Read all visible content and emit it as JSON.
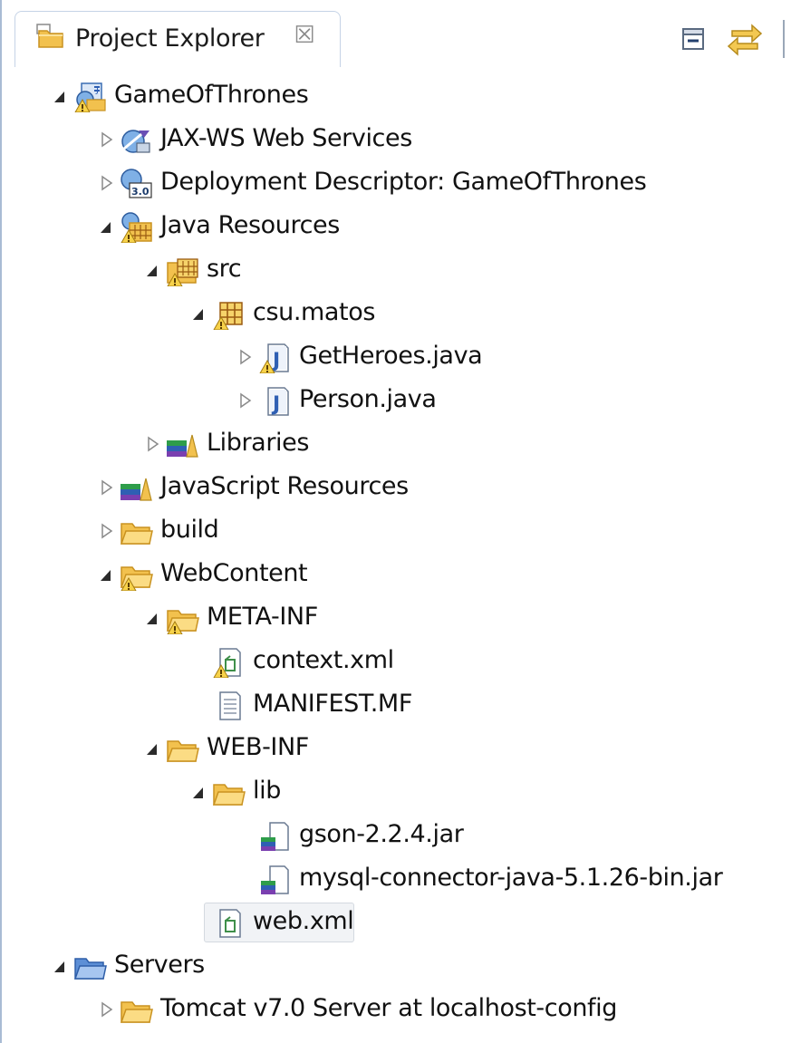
{
  "panel": {
    "title": "Project Explorer",
    "close_glyph": "☒",
    "toolbar": [
      {
        "name": "collapse-all-icon"
      },
      {
        "name": "link-with-editor-icon"
      }
    ]
  },
  "colors": {
    "folder": "#f2c14e",
    "folder_dark": "#c99220",
    "server_folder": "#5d8fd6",
    "java_blue": "#2f5fb3",
    "selection": "#f1f3f6"
  },
  "tree": [
    {
      "label": "GameOfThrones",
      "icon": "web-project-icon",
      "expand": "expanded",
      "level": 0,
      "warn": true
    },
    {
      "label": "JAX-WS Web Services",
      "icon": "webservices-icon",
      "expand": "collapsed",
      "level": 1
    },
    {
      "label": "Deployment Descriptor: GameOfThrones",
      "icon": "deployment-descriptor-icon",
      "expand": "collapsed",
      "level": 1,
      "badge": "3.0"
    },
    {
      "label": "Java Resources",
      "icon": "java-resources-icon",
      "expand": "expanded",
      "level": 1,
      "warn": true
    },
    {
      "label": "src",
      "icon": "source-folder-icon",
      "expand": "expanded",
      "level": 2,
      "warn": true
    },
    {
      "label": "csu.matos",
      "icon": "package-icon",
      "expand": "expanded",
      "level": 3,
      "warn": true
    },
    {
      "label": "GetHeroes.java",
      "icon": "java-file-icon",
      "expand": "collapsed",
      "level": 4,
      "warn": true
    },
    {
      "label": "Person.java",
      "icon": "java-file-icon",
      "expand": "collapsed",
      "level": 4
    },
    {
      "label": "Libraries",
      "icon": "libraries-icon",
      "expand": "collapsed",
      "level": 2
    },
    {
      "label": "JavaScript Resources",
      "icon": "libraries-icon",
      "expand": "collapsed",
      "level": 1
    },
    {
      "label": "build",
      "icon": "folder-icon",
      "expand": "collapsed",
      "level": 1
    },
    {
      "label": "WebContent",
      "icon": "folder-icon",
      "expand": "expanded",
      "level": 1,
      "warn": true
    },
    {
      "label": "META-INF",
      "icon": "folder-icon",
      "expand": "expanded",
      "level": 2,
      "warn": true
    },
    {
      "label": "context.xml",
      "icon": "xml-file-icon",
      "expand": "none",
      "level": 3,
      "warn": true
    },
    {
      "label": "MANIFEST.MF",
      "icon": "text-file-icon",
      "expand": "none",
      "level": 3
    },
    {
      "label": "WEB-INF",
      "icon": "folder-icon",
      "expand": "expanded",
      "level": 2
    },
    {
      "label": "lib",
      "icon": "folder-icon",
      "expand": "expanded",
      "level": 3
    },
    {
      "label": "gson-2.2.4.jar",
      "icon": "jar-file-icon",
      "expand": "none",
      "level": 4
    },
    {
      "label": "mysql-connector-java-5.1.26-bin.jar",
      "icon": "jar-file-icon",
      "expand": "none",
      "level": 4
    },
    {
      "label": "web.xml",
      "icon": "xml-file-icon",
      "expand": "none",
      "level": 3,
      "selected": true
    },
    {
      "label": "Servers",
      "icon": "server-folder-icon",
      "expand": "expanded",
      "level": 0
    },
    {
      "label": "Tomcat v7.0 Server at localhost-config",
      "icon": "folder-icon",
      "expand": "collapsed",
      "level": 1
    }
  ]
}
